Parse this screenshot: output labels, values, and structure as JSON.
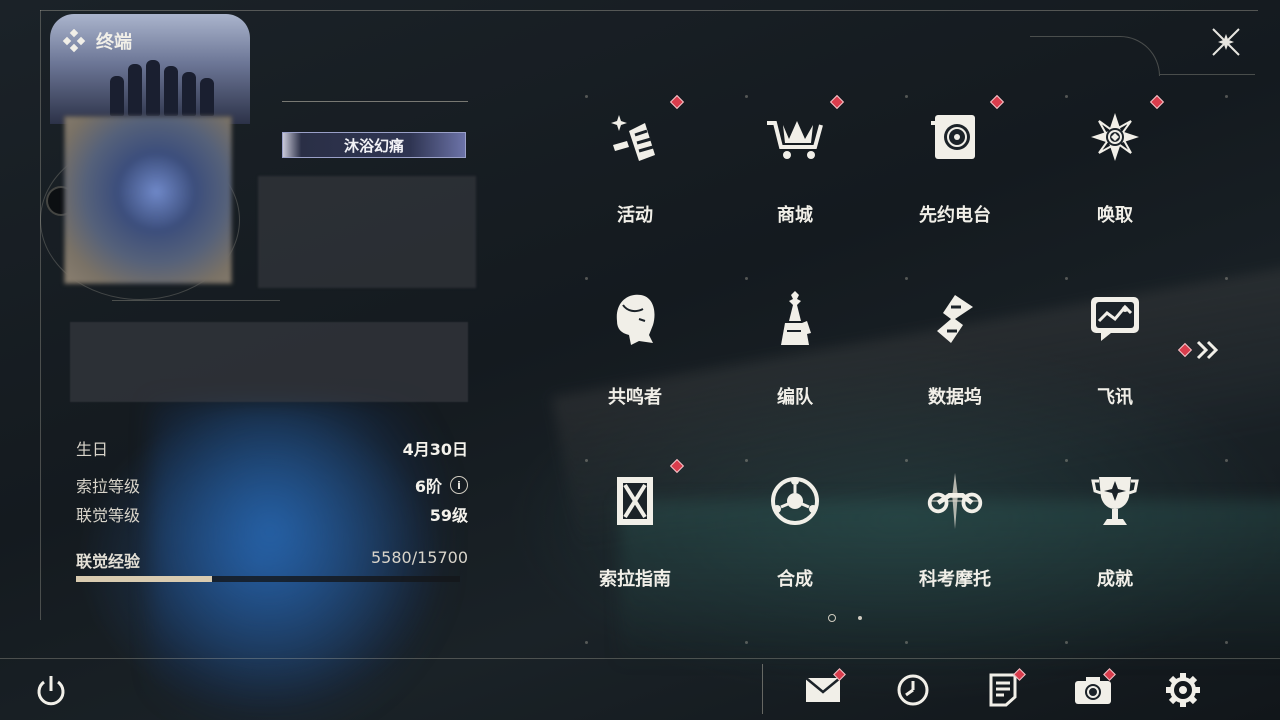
{
  "header": {
    "title": "终端"
  },
  "profile": {
    "title_badge": "沐浴幻痛",
    "info": [
      {
        "label": "生日",
        "value": "4月30日"
      },
      {
        "label": "索拉等级",
        "value": "6阶"
      },
      {
        "label": "联觉等级",
        "value": "59级"
      }
    ],
    "exp": {
      "label": "联觉经验",
      "value_text": "5580/15700",
      "current": 5580,
      "max": 15700
    }
  },
  "menu": {
    "items": [
      {
        "label": "活动",
        "icon": "sparkle-flag-icon",
        "badge": true
      },
      {
        "label": "商城",
        "icon": "shopping-cart-icon",
        "badge": true
      },
      {
        "label": "先约电台",
        "icon": "radio-speaker-icon",
        "badge": true
      },
      {
        "label": "唤取",
        "icon": "compass-star-icon",
        "badge": true
      },
      {
        "label": "共鸣者",
        "icon": "character-portrait-icon",
        "badge": false
      },
      {
        "label": "编队",
        "icon": "chess-pieces-icon",
        "badge": false
      },
      {
        "label": "数据坞",
        "icon": "data-dock-icon",
        "badge": false
      },
      {
        "label": "飞讯",
        "icon": "message-bubble-icon",
        "badge": false
      },
      {
        "label": "索拉指南",
        "icon": "guide-book-icon",
        "badge": true
      },
      {
        "label": "合成",
        "icon": "synthesis-orb-icon",
        "badge": false
      },
      {
        "label": "科考摩托",
        "icon": "motorbike-icon",
        "badge": false
      },
      {
        "label": "成就",
        "icon": "trophy-icon",
        "badge": false
      }
    ],
    "page_current": 1,
    "page_total": 2
  },
  "bottom_bar": {
    "buttons": [
      {
        "name": "mail",
        "icon": "mail-icon",
        "badge": true
      },
      {
        "name": "clock",
        "icon": "clock-icon",
        "badge": false
      },
      {
        "name": "notes",
        "icon": "notes-icon",
        "badge": true
      },
      {
        "name": "camera",
        "icon": "camera-icon",
        "badge": true
      },
      {
        "name": "settings",
        "icon": "gear-icon",
        "badge": false
      }
    ]
  },
  "colors": {
    "badge": "#d93c4c",
    "text": "#f1efe8",
    "exp_fill": "#d9cbb0"
  }
}
